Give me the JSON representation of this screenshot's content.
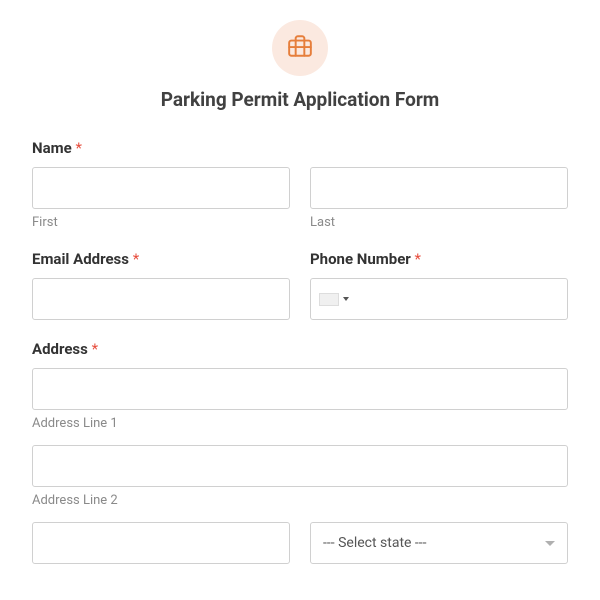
{
  "header": {
    "icon": "briefcase-icon",
    "title": "Parking Permit Application Form"
  },
  "fields": {
    "name": {
      "label": "Name",
      "required_mark": "*",
      "first_sublabel": "First",
      "last_sublabel": "Last"
    },
    "email": {
      "label": "Email Address",
      "required_mark": "*"
    },
    "phone": {
      "label": "Phone Number",
      "required_mark": "*"
    },
    "address": {
      "label": "Address",
      "required_mark": "*",
      "line1_sublabel": "Address Line 1",
      "line2_sublabel": "Address Line 2",
      "state_placeholder": "--- Select state ---"
    }
  }
}
